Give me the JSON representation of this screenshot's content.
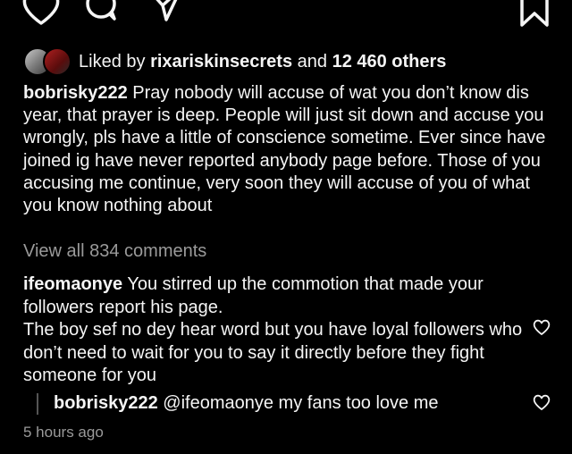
{
  "post": {
    "icons": [
      "heart-icon",
      "comment-icon",
      "share-icon",
      "bookmark-icon"
    ],
    "likes": {
      "prefix": "Liked by",
      "user": "rixariskinsecrets",
      "joiner": "and",
      "others": "12 460 others"
    },
    "caption": {
      "username": "bobrisky222",
      "text": "Pray nobody will accuse of wat you don’t know dis year, that prayer is deep.  People will just sit down and accuse you wrongly, pls have a little of conscience sometime. Ever since have joined ig have never reported anybody page before. Those of you accusing me continue, very soon they will accuse of you of what you know nothing about"
    },
    "view_all_comments": "View all 834 comments",
    "comments": [
      {
        "username": "ifeomaonye",
        "text_line1": "You stirred up the commotion that made your followers report his page.",
        "text_line2": "The boy sef no dey hear word but you have loyal followers who don’t need to wait for you to say it directly before they fight someone for you"
      }
    ],
    "reply": {
      "username": "bobrisky222",
      "text": "@ifeomaonye my fans too love me"
    },
    "timestamp": "5 hours ago"
  }
}
